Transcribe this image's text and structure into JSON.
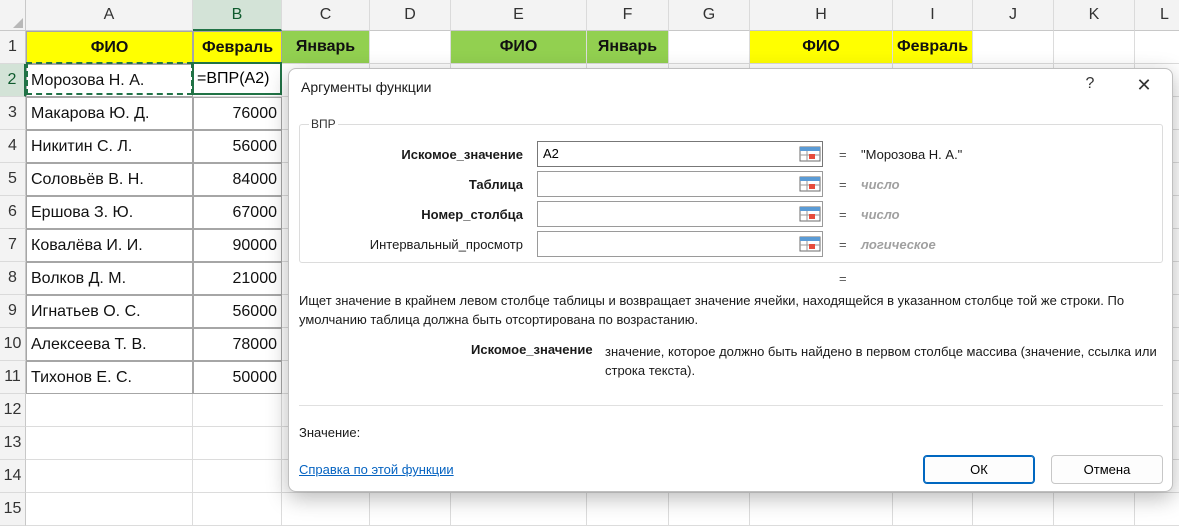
{
  "spreadsheet": {
    "columns": [
      "A",
      "B",
      "C",
      "D",
      "E",
      "F",
      "G",
      "H",
      "I",
      "J",
      "K",
      "L"
    ],
    "rows": [
      "1",
      "2",
      "3",
      "4",
      "5",
      "6",
      "7",
      "8",
      "9",
      "10",
      "11",
      "12",
      "13",
      "14",
      "15"
    ],
    "active_column": "B",
    "active_row": "2",
    "header_row": {
      "a1": "ФИО",
      "b1": "Февраль",
      "c1": "Январь",
      "e1": "ФИО",
      "f1": "Январь",
      "h1": "ФИО",
      "i1": "Февраль"
    },
    "names": [
      "Морозова Н. А.",
      "Макарова Ю. Д.",
      "Никитин С. Л.",
      "Соловьёв В. Н.",
      "Ершова З. Ю.",
      "Ковалёва И. И.",
      "Волков Д. М.",
      "Игнатьев О. С.",
      "Алексеева Т. В.",
      "Тихонов Е. С."
    ],
    "february": [
      "",
      "76000",
      "56000",
      "84000",
      "67000",
      "90000",
      "21000",
      "56000",
      "78000",
      "50000"
    ],
    "editing_formula": "=ВПР(A2)",
    "colors": {
      "yellow": "#ffff00",
      "green": "#92d050",
      "selection": "#217346"
    }
  },
  "dialog": {
    "title": "Аргументы функции",
    "help_glyph": "?",
    "close_glyph": "✕",
    "function_name": "ВПР",
    "arguments": [
      {
        "label": "Искомое_значение",
        "value": "A2",
        "equals": "=",
        "result": "\"Морозова Н. А.\"",
        "result_type": "value"
      },
      {
        "label": "Таблица",
        "value": "",
        "equals": "=",
        "result": "число",
        "result_type": "hint"
      },
      {
        "label": "Номер_столбца",
        "value": "",
        "equals": "=",
        "result": "число",
        "result_type": "hint"
      },
      {
        "label": "Интервальный_просмотр",
        "value": "",
        "equals": "=",
        "result": "логическое",
        "result_type": "hint"
      }
    ],
    "formula_equals": "=",
    "description": "Ищет значение в крайнем левом столбце таблицы и возвращает значение ячейки, находящейся в указанном столбце той же строки. По умолчанию таблица должна быть отсортирована по возрастанию.",
    "arg_help_name": "Искомое_значение",
    "arg_help_text": "значение, которое должно быть найдено в первом столбце массива (значение, ссылка или строка текста).",
    "value_label": "Значение:",
    "help_link": "Справка по этой функции",
    "ok_label": "ОК",
    "cancel_label": "Отмена",
    "icons": {
      "collapse": "range-select-icon"
    }
  }
}
